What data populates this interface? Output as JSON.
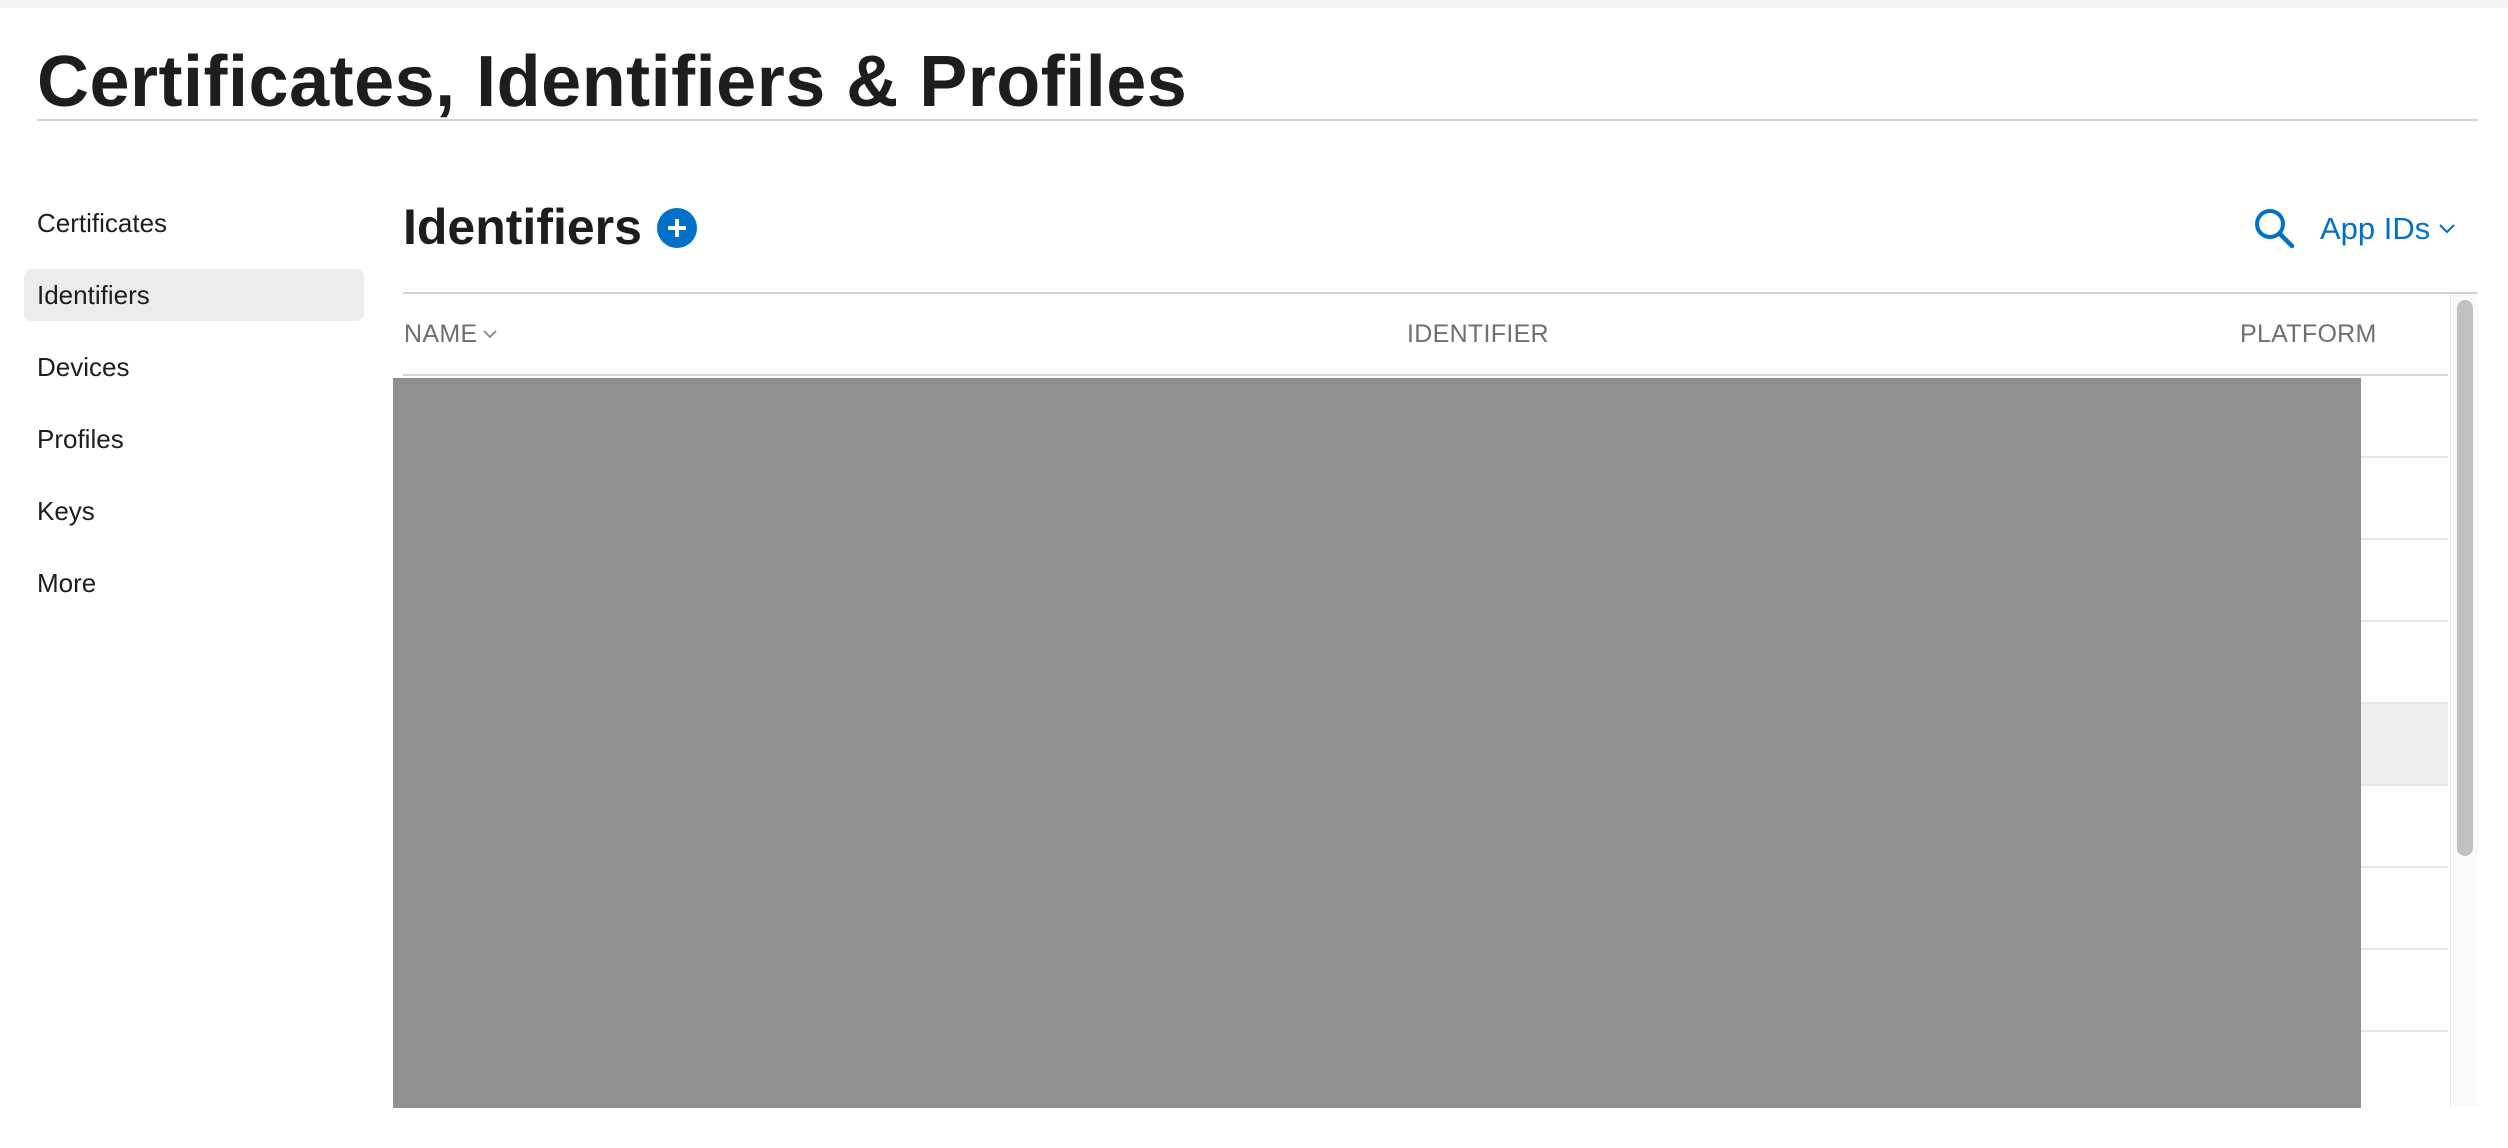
{
  "page": {
    "title": "Certificates, Identifiers & Profiles"
  },
  "sidebar": {
    "items": [
      {
        "label": "Certificates",
        "active": false
      },
      {
        "label": "Identifiers",
        "active": true
      },
      {
        "label": "Devices",
        "active": false
      },
      {
        "label": "Profiles",
        "active": false
      },
      {
        "label": "Keys",
        "active": false
      },
      {
        "label": "More",
        "active": false
      }
    ]
  },
  "section": {
    "title": "Identifiers",
    "add_icon": "plus-circle-icon",
    "search_icon": "search-icon",
    "filter_label": "App IDs",
    "filter_icon": "chevron-down-icon"
  },
  "table": {
    "columns": [
      {
        "label": "NAME",
        "sortable": true
      },
      {
        "label": "IDENTIFIER",
        "sortable": false
      },
      {
        "label": "PLATFORM",
        "sortable": false
      }
    ],
    "rows_redacted": true
  },
  "colors": {
    "accent": "#0070c9",
    "text": "#1d1d1f",
    "muted": "#6e6e73",
    "active_bg": "#ececec",
    "redaction": "#909090"
  }
}
